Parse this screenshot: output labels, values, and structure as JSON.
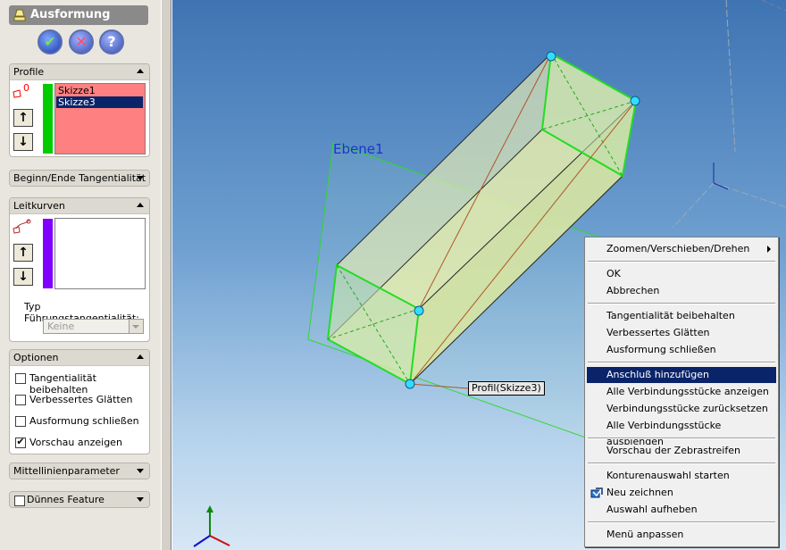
{
  "panel": {
    "title": "Ausformung",
    "buttons": {
      "ok": "✔",
      "cancel": "✕",
      "help": "?"
    },
    "profile": {
      "title": "Profile",
      "icon": "profile-sketch-icon",
      "badge": "0",
      "items": [
        "Skizze1",
        "Skizze3"
      ],
      "selected_index": 1,
      "bar_color": "#00cc00",
      "list_bg": "#ff8080"
    },
    "tangency": {
      "title": "Beginn/Ende Tangentialität"
    },
    "guides": {
      "title": "Leitkurven",
      "icon": "guide-curve-icon",
      "bar_color": "#8000ff",
      "tangency_label": "Typ Führungstangentialität:",
      "tangency_value": "Keine"
    },
    "options": {
      "title": "Optionen",
      "items": [
        {
          "label": "Tangentialität beibehalten",
          "checked": false
        },
        {
          "label": "Verbessertes Glätten",
          "checked": false
        },
        {
          "label": "Ausformung schließen",
          "checked": false
        },
        {
          "label": "Vorschau anzeigen",
          "checked": true
        }
      ]
    },
    "centerline": {
      "title": "Mittellinienparameter"
    },
    "thin": {
      "title": "Dünnes Feature",
      "checked": false
    }
  },
  "viewport": {
    "plane_label": "Ebene1",
    "tooltip": "Profil(Skizze3)"
  },
  "context_menu": {
    "items": [
      {
        "label": "Zoomen/Verschieben/Drehen",
        "submenu": true
      },
      {
        "label": "OK"
      },
      {
        "label": "Abbrechen"
      },
      {
        "label": "Tangentialität beibehalten"
      },
      {
        "label": "Verbessertes Glätten"
      },
      {
        "label": "Ausformung schließen"
      },
      {
        "label": "Anschluß hinzufügen",
        "highlighted": true
      },
      {
        "label": "Alle Verbindungsstücke anzeigen"
      },
      {
        "label": "Verbindungsstücke zurücksetzen"
      },
      {
        "label": "Alle Verbindungsstücke ausblenden"
      },
      {
        "label": "Vorschau der Zebrastreifen"
      },
      {
        "label": "Konturenauswahl starten"
      },
      {
        "label": "Neu zeichnen",
        "icon": "redraw-icon"
      },
      {
        "label": "Auswahl aufheben"
      },
      {
        "label": "Menü anpassen"
      }
    ],
    "highlight_color": "#0a246a"
  }
}
